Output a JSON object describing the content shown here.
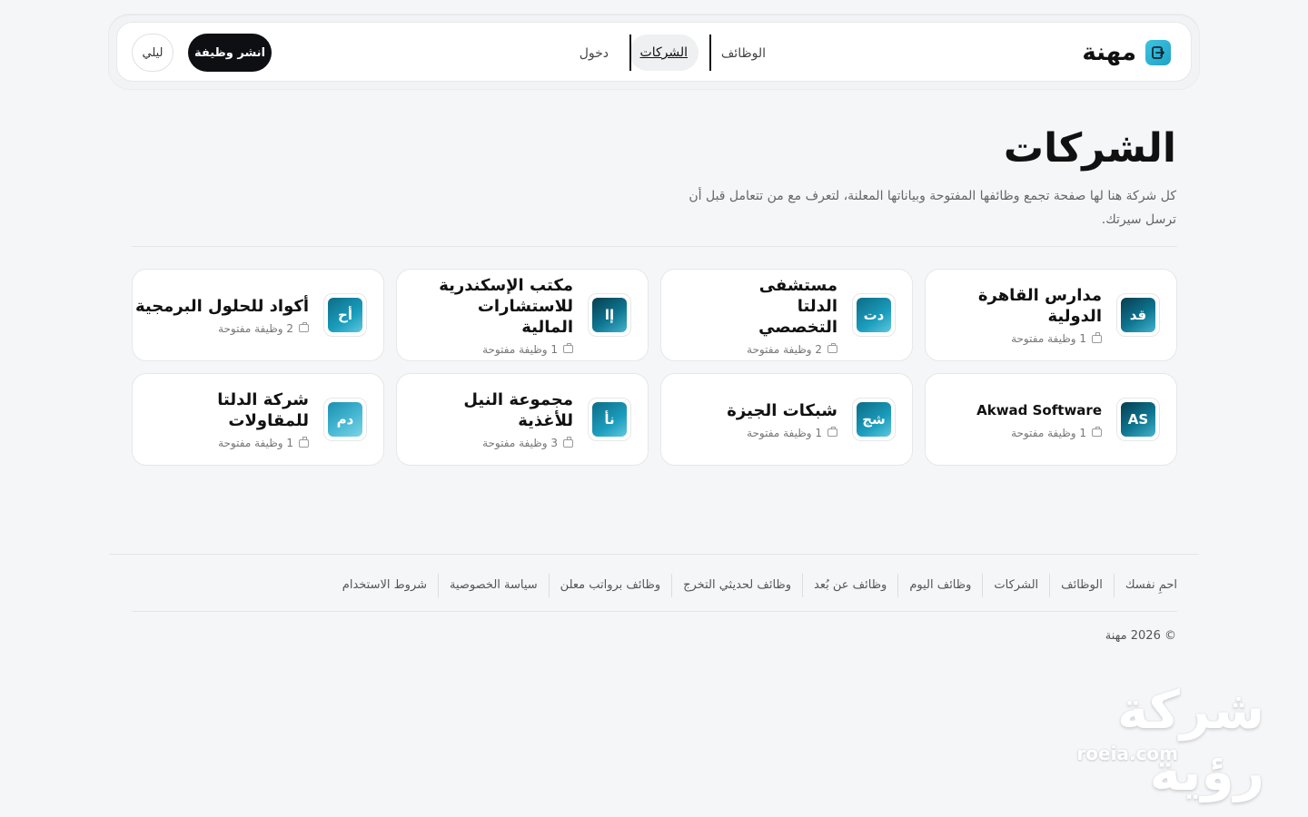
{
  "header": {
    "brand": "مهنة",
    "nav": {
      "jobs": "الوظائف",
      "companies": "الشركات",
      "login": "دخول"
    },
    "post_job": "انشر وظيفة",
    "theme_toggle": "ليلي"
  },
  "page": {
    "title": "الشركات",
    "description": "كل شركة هنا لها صفحة تجمع وظائفها المفتوحة وبياناتها المعلنة، لتعرف مع من تتعامل قبل أن ترسل سيرتك."
  },
  "companies": [
    {
      "initials": "قد",
      "name": "مدارس القاهرة الدولية",
      "open_jobs": "1 وظيفة مفتوحة"
    },
    {
      "initials": "دت",
      "name": "مستشفى الدلتا التخصصي",
      "open_jobs": "2 وظيفة مفتوحة"
    },
    {
      "initials": "إا",
      "name": "مكتب الإسكندرية للاستشارات المالية",
      "open_jobs": "1 وظيفة مفتوحة"
    },
    {
      "initials": "أح",
      "name": "أكواد للحلول البرمجية",
      "open_jobs": "2 وظيفة مفتوحة"
    },
    {
      "initials": "AS",
      "name": "Akwad Software",
      "open_jobs": "1 وظيفة مفتوحة"
    },
    {
      "initials": "شج",
      "name": "شبكات الجيزة",
      "open_jobs": "1 وظيفة مفتوحة"
    },
    {
      "initials": "نأ",
      "name": "مجموعة النيل للأغذية",
      "open_jobs": "3 وظيفة مفتوحة"
    },
    {
      "initials": "دم",
      "name": "شركة الدلتا للمقاولات",
      "open_jobs": "1 وظيفة مفتوحة"
    }
  ],
  "footer": {
    "links": [
      "احمِ نفسك",
      "الوظائف",
      "الشركات",
      "وظائف اليوم",
      "وظائف عن بُعد",
      "وظائف لحديثي التخرج",
      "وظائف برواتب معلن",
      "سياسة الخصوصية",
      "شروط الاستخدام"
    ],
    "copyright": "© 2026 مهنة"
  },
  "watermark": {
    "text": "شركة رؤية",
    "url": "roeia.com"
  },
  "colors": {
    "accent": "#1ea3c8",
    "primary_button": "#0d0f12",
    "background": "#f5f6f8"
  },
  "icons": {
    "brand": "logout-square-icon",
    "card_meta": "briefcase-icon"
  }
}
